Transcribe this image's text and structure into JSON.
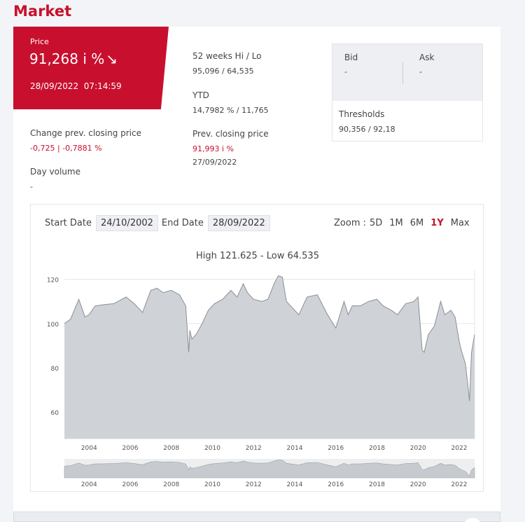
{
  "title": "Market",
  "price": {
    "label": "Price",
    "value": "91,268 i %",
    "arrow": "↘",
    "timestamp": "28/09/2022  07:14:59"
  },
  "stats": {
    "change_label": "Change prev. closing price",
    "change_value": "-0,725 | -0,7881 %",
    "volume_label": "Day volume",
    "volume_value": "-",
    "hilo_label": "52 weeks Hi / Lo",
    "hilo_value": "95,096 / 64,535",
    "ytd_label": "YTD",
    "ytd_value": "14,7982 % / 11,765",
    "prev_label": "Prev. closing price",
    "prev_value": "91,993 i %",
    "prev_date": "27/09/2022"
  },
  "bidask": {
    "bid_label": "Bid",
    "bid_value": "-",
    "ask_label": "Ask",
    "ask_value": "-",
    "thresholds_label": "Thresholds",
    "thresholds_value": "90,356 / 92,18"
  },
  "chart_controls": {
    "start_label": "Start Date",
    "start_value": "24/10/2002",
    "end_label": "End Date",
    "end_value": "28/09/2022",
    "zoom_label": "Zoom :",
    "zoom_options": [
      "5D",
      "1M",
      "6M",
      "1Y",
      "Max"
    ],
    "zoom_active": "1Y"
  },
  "chart_data": {
    "type": "area",
    "title": "High 121.625 - Low 64.535",
    "ylim": [
      48,
      124
    ],
    "xlim": [
      2002.8,
      2022.75
    ],
    "yticks": [
      60,
      80,
      100,
      120
    ],
    "xticks": [
      2004,
      2006,
      2008,
      2010,
      2012,
      2014,
      2016,
      2018,
      2020,
      2022
    ],
    "grid": true,
    "colors": {
      "fill": "#cfd3d8",
      "line": "#8a8f96"
    },
    "x": [
      2002.8,
      2003.1,
      2003.5,
      2003.8,
      2004.0,
      2004.3,
      2004.7,
      2005.2,
      2005.8,
      2006.2,
      2006.6,
      2007.0,
      2007.3,
      2007.6,
      2008.0,
      2008.4,
      2008.7,
      2008.85,
      2008.9,
      2009.0,
      2009.2,
      2009.5,
      2009.8,
      2010.1,
      2010.5,
      2010.9,
      2011.2,
      2011.5,
      2011.7,
      2012.0,
      2012.4,
      2012.7,
      2013.0,
      2013.2,
      2013.4,
      2013.6,
      2014.2,
      2014.6,
      2015.1,
      2015.6,
      2016.0,
      2016.4,
      2016.6,
      2016.8,
      2017.2,
      2017.6,
      2018.0,
      2018.3,
      2018.7,
      2019.0,
      2019.4,
      2019.8,
      2020.0,
      2020.2,
      2020.3,
      2020.5,
      2020.8,
      2021.1,
      2021.3,
      2021.6,
      2021.8,
      2022.0,
      2022.1,
      2022.3,
      2022.45,
      2022.5,
      2022.6,
      2022.75
    ],
    "values": [
      100,
      102,
      111,
      103,
      104,
      108,
      108.5,
      109,
      112,
      109,
      105,
      115,
      116,
      114,
      115,
      113,
      108,
      87,
      97,
      93,
      95,
      100,
      106,
      109,
      111,
      115,
      112,
      118,
      114,
      111,
      110,
      111,
      118,
      121.6,
      121,
      110,
      104,
      112,
      113,
      104,
      98,
      110,
      104,
      108,
      108,
      110,
      111,
      108,
      106,
      104,
      109,
      110,
      112,
      88,
      87,
      95,
      99,
      110,
      104,
      106,
      103,
      92,
      88,
      82,
      70,
      65,
      87,
      95
    ]
  }
}
